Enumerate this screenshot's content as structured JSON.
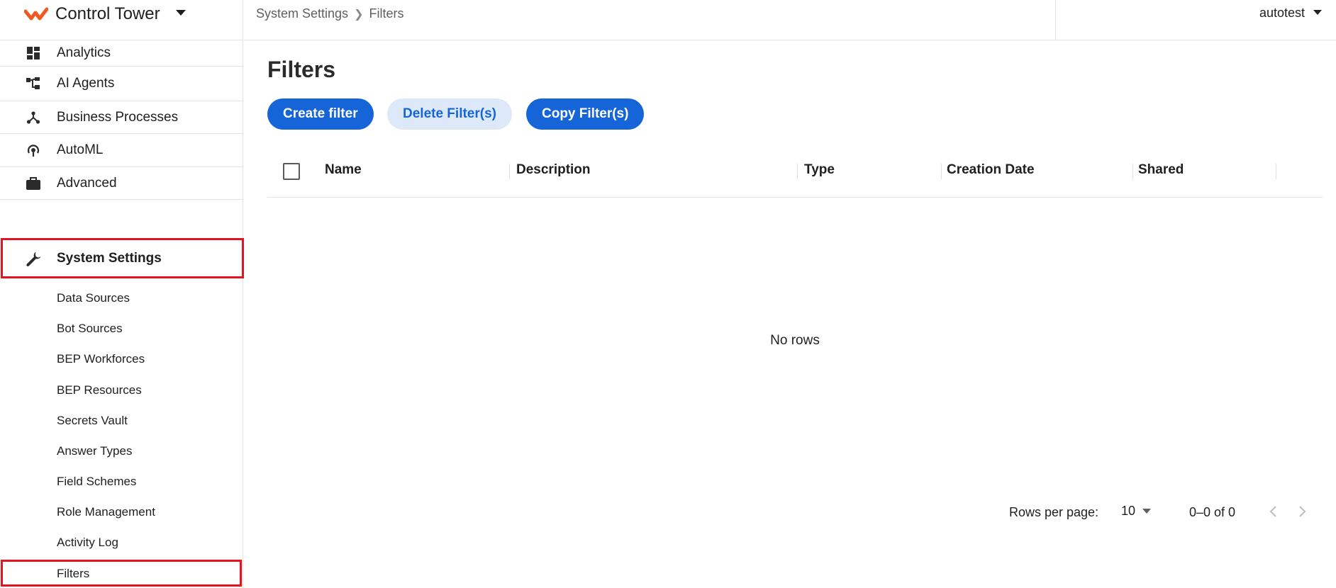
{
  "brand": {
    "title": "Control Tower",
    "accent": "#f05a22"
  },
  "nav": {
    "items": [
      {
        "label": "Analytics",
        "icon": "dashboard-icon"
      },
      {
        "label": "AI Agents",
        "icon": "hierarchy-icon"
      },
      {
        "label": "Business Processes",
        "icon": "process-icon"
      },
      {
        "label": "AutoML",
        "icon": "automl-icon"
      },
      {
        "label": "Advanced",
        "icon": "briefcase-icon"
      },
      {
        "label": "System Settings",
        "icon": "wrench-icon",
        "active": true
      }
    ],
    "subitems": [
      "Data Sources",
      "Bot Sources",
      "BEP Workforces",
      "BEP Resources",
      "Secrets Vault",
      "Answer Types",
      "Field Schemes",
      "Role Management",
      "Activity Log",
      "Filters"
    ]
  },
  "breadcrumb": {
    "parent": "System Settings",
    "current": "Filters"
  },
  "user": {
    "name": "autotest"
  },
  "page": {
    "title": "Filters"
  },
  "toolbar": {
    "create": "Create filter",
    "delete": "Delete Filter(s)",
    "copy": "Copy Filter(s)"
  },
  "table": {
    "columns": [
      "Name",
      "Description",
      "Type",
      "Creation Date",
      "Shared"
    ],
    "empty_text": "No rows"
  },
  "pagination": {
    "rows_per_page_label": "Rows per page:",
    "rows_per_page": "10",
    "range": "0–0 of 0"
  },
  "colors": {
    "primary": "#1565d8",
    "highlight": "#e3131f"
  }
}
